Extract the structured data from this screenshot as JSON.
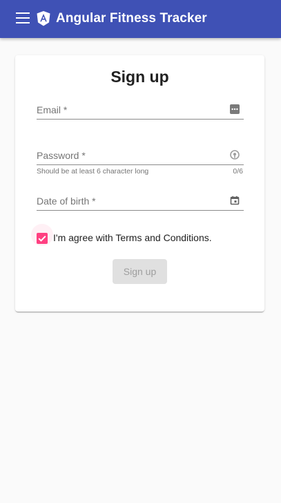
{
  "app": {
    "title": "Angular Fitness Tracker"
  },
  "icons": {
    "menu": "menu-icon",
    "logo": "angular-logo",
    "email": "more-horiz-box-icon",
    "password": "password-visibility-icon",
    "date": "calendar-icon"
  },
  "colors": {
    "toolbar": "#3f51b5",
    "accent": "#ff4081",
    "background": "#fafafa"
  },
  "signup": {
    "title": "Sign up",
    "email_label": "Email *",
    "password_label": "Password *",
    "password_hint": "Should be at least 6 character long",
    "password_counter": "0/6",
    "dob_label": "Date of birth *",
    "terms_label": "I'm agree with Terms and Conditions.",
    "terms_checked": true,
    "submit_label": "Sign up",
    "submit_disabled": true
  }
}
